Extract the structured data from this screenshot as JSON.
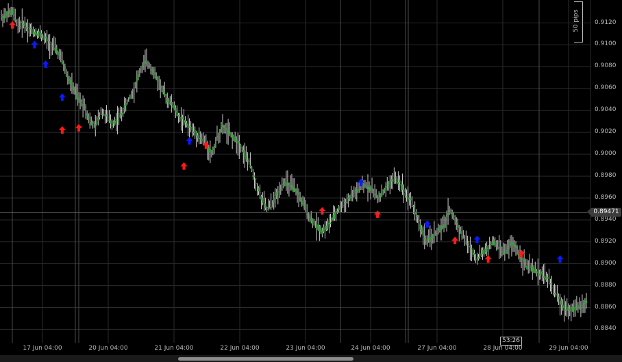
{
  "chart": {
    "pips_label": "50 pips",
    "current_price": "0.89471",
    "bar_timer": "53:26",
    "colors": {
      "background": "#000000",
      "candle": "#3fa33f",
      "wick": "#cfcfcf",
      "grid": "#2b2b2b",
      "buy_arrow": "#0a1aff",
      "sell_arrow": "#ff1a1a"
    }
  },
  "chart_data": {
    "type": "line",
    "ylim": [
      0.8834,
      0.9136
    ],
    "y_ticks": [
      "0.9120",
      "0.9100",
      "0.9080",
      "0.9060",
      "0.9040",
      "0.9020",
      "0.9000",
      "0.8980",
      "0.8960",
      "0.8940",
      "0.8920",
      "0.8900",
      "0.8880",
      "0.8860",
      "0.8840"
    ],
    "x_ticks": [
      "17 Jun 04:00",
      "20 Jun 04:00",
      "21 Jun 04:00",
      "22 Jun 04:00",
      "23 Jun 04:00",
      "24 Jun 04:00",
      "27 Jun 04:00",
      "28 Jun 04:00",
      "29 Jun 04:00"
    ],
    "price_path": [
      [
        0,
        0.9125
      ],
      [
        2,
        0.9128
      ],
      [
        4,
        0.913
      ],
      [
        6,
        0.9118
      ],
      [
        8,
        0.912
      ],
      [
        10,
        0.9114
      ],
      [
        12,
        0.9112
      ],
      [
        14,
        0.911
      ],
      [
        16,
        0.9105
      ],
      [
        18,
        0.91
      ],
      [
        20,
        0.9095
      ],
      [
        22,
        0.9085
      ],
      [
        24,
        0.907
      ],
      [
        26,
        0.906
      ],
      [
        28,
        0.905
      ],
      [
        30,
        0.9045
      ],
      [
        32,
        0.903
      ],
      [
        34,
        0.9025
      ],
      [
        36,
        0.904
      ],
      [
        38,
        0.9035
      ],
      [
        40,
        0.9028
      ],
      [
        42,
        0.9032
      ],
      [
        44,
        0.904
      ],
      [
        46,
        0.905
      ],
      [
        48,
        0.906
      ],
      [
        50,
        0.9075
      ],
      [
        52,
        0.9085
      ],
      [
        54,
        0.908
      ],
      [
        56,
        0.907
      ],
      [
        58,
        0.906
      ],
      [
        60,
        0.905
      ],
      [
        62,
        0.9045
      ],
      [
        64,
        0.9035
      ],
      [
        66,
        0.903
      ],
      [
        68,
        0.9025
      ],
      [
        70,
        0.902
      ],
      [
        72,
        0.9015
      ],
      [
        74,
        0.901
      ],
      [
        76,
        0.9
      ],
      [
        78,
        0.9015
      ],
      [
        80,
        0.9025
      ],
      [
        82,
        0.902
      ],
      [
        84,
        0.9015
      ],
      [
        86,
        0.901
      ],
      [
        88,
        0.9
      ],
      [
        90,
        0.899
      ],
      [
        92,
        0.8975
      ],
      [
        94,
        0.896
      ],
      [
        96,
        0.895
      ],
      [
        98,
        0.8955
      ],
      [
        100,
        0.8965
      ],
      [
        102,
        0.8975
      ],
      [
        104,
        0.8972
      ],
      [
        106,
        0.8968
      ],
      [
        108,
        0.896
      ],
      [
        110,
        0.895
      ],
      [
        112,
        0.894
      ],
      [
        114,
        0.8935
      ],
      [
        116,
        0.893
      ],
      [
        118,
        0.8935
      ],
      [
        120,
        0.8942
      ],
      [
        122,
        0.895
      ],
      [
        124,
        0.8955
      ],
      [
        126,
        0.896
      ],
      [
        128,
        0.8965
      ],
      [
        130,
        0.897
      ],
      [
        132,
        0.8972
      ],
      [
        134,
        0.8968
      ],
      [
        136,
        0.896
      ],
      [
        138,
        0.8965
      ],
      [
        140,
        0.8972
      ],
      [
        142,
        0.8978
      ],
      [
        144,
        0.8975
      ],
      [
        146,
        0.8965
      ],
      [
        148,
        0.8958
      ],
      [
        150,
        0.8945
      ],
      [
        152,
        0.893
      ],
      [
        154,
        0.892
      ],
      [
        156,
        0.8925
      ],
      [
        158,
        0.893
      ],
      [
        160,
        0.8935
      ],
      [
        162,
        0.895
      ],
      [
        164,
        0.894
      ],
      [
        166,
        0.893
      ],
      [
        168,
        0.892
      ],
      [
        170,
        0.8912
      ],
      [
        172,
        0.8905
      ],
      [
        174,
        0.891
      ],
      [
        176,
        0.8915
      ],
      [
        178,
        0.892
      ],
      [
        180,
        0.8915
      ],
      [
        182,
        0.891
      ],
      [
        184,
        0.8918
      ],
      [
        186,
        0.8915
      ],
      [
        188,
        0.8905
      ],
      [
        190,
        0.8898
      ],
      [
        192,
        0.8895
      ],
      [
        194,
        0.8892
      ],
      [
        196,
        0.889
      ],
      [
        198,
        0.8885
      ],
      [
        200,
        0.8875
      ],
      [
        202,
        0.8865
      ],
      [
        204,
        0.886
      ],
      [
        206,
        0.8858
      ],
      [
        208,
        0.886
      ],
      [
        210,
        0.8862
      ],
      [
        212,
        0.8865
      ]
    ],
    "buy_markers": [
      [
        12,
        0.91
      ],
      [
        16,
        0.9082
      ],
      [
        22,
        0.9052
      ],
      [
        68,
        0.9012
      ],
      [
        130,
        0.8974
      ],
      [
        154,
        0.8936
      ],
      [
        172,
        0.8922
      ],
      [
        202,
        0.8904
      ]
    ],
    "sell_markers": [
      [
        4,
        0.9118
      ],
      [
        22,
        0.9022
      ],
      [
        28,
        0.9024
      ],
      [
        66,
        0.8989
      ],
      [
        74,
        0.9008
      ],
      [
        116,
        0.8948
      ],
      [
        136,
        0.8945
      ],
      [
        164,
        0.8921
      ],
      [
        176,
        0.8904
      ],
      [
        188,
        0.8909
      ]
    ]
  }
}
